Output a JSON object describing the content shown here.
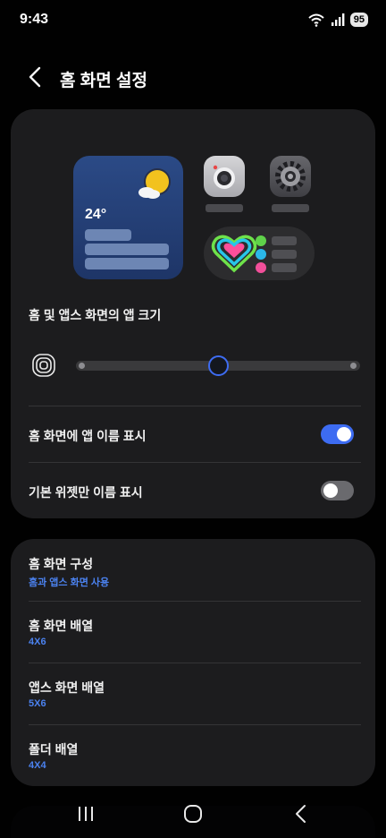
{
  "status_bar": {
    "time": "9:43",
    "battery": "95"
  },
  "header": {
    "title": "홈 화면 설정"
  },
  "preview": {
    "weather_temp": "24°"
  },
  "app_size": {
    "label": "홈 및 앱스 화면의 앱 크기",
    "slider_level_fraction": 0.5
  },
  "toggles": [
    {
      "label": "홈 화면에 앱 이름 표시",
      "on": true
    },
    {
      "label": "기본 위젯만 이름 표시",
      "on": false
    }
  ],
  "menu": [
    {
      "title": "홈 화면 구성",
      "value": "홈과 앱스 화면 사용"
    },
    {
      "title": "홈 화면 배열",
      "value": "4X6"
    },
    {
      "title": "앱스 화면 배열",
      "value": "5X6"
    },
    {
      "title": "폴더 배열",
      "value": "4X4"
    }
  ],
  "colors": {
    "accent": "#3d6cf2",
    "sub_text": "#4b82f0",
    "card": "#1c1c1e",
    "background": "#010101"
  },
  "icons": [
    "back-icon",
    "wifi-icon",
    "signal-icon",
    "camera-icon",
    "settings-icon",
    "health-icon",
    "app-size-icon",
    "recents-icon",
    "home-icon",
    "nav-back-icon"
  ]
}
